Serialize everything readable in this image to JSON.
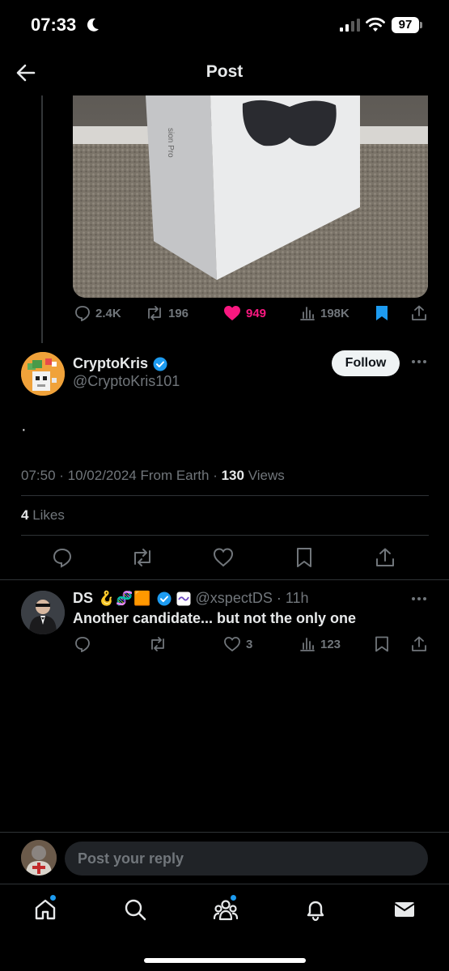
{
  "status_bar": {
    "time": "07:33",
    "battery": "97"
  },
  "header": {
    "title": "Post"
  },
  "parent_post": {
    "stats": {
      "replies": "2.4K",
      "reposts": "196",
      "likes": "949",
      "views": "198K"
    },
    "colors": {
      "like": "#f91880",
      "bookmark": "#1d9bf0"
    }
  },
  "main_post": {
    "author_name": "CryptoKris",
    "author_handle": "@CryptoKris101",
    "follow_label": "Follow",
    "text": "·",
    "meta_prefix": "07:50 · 10/02/2024 From Earth · ",
    "views_count": "130",
    "views_label": " Views",
    "likes_count": "4",
    "likes_label": " Likes"
  },
  "reply": {
    "name": "DS",
    "emoji": "🪝🧬🟧",
    "handle_time": "@xspectDS · 11h",
    "text": "Another candidate... but not the only one",
    "likes": "3",
    "views": "123"
  },
  "composer": {
    "placeholder": "Post your reply"
  },
  "tab_bar": {
    "items": [
      "home-icon",
      "search-icon",
      "communities-icon",
      "notifications-icon",
      "messages-icon"
    ]
  },
  "accent_color": "#1d9bf0"
}
